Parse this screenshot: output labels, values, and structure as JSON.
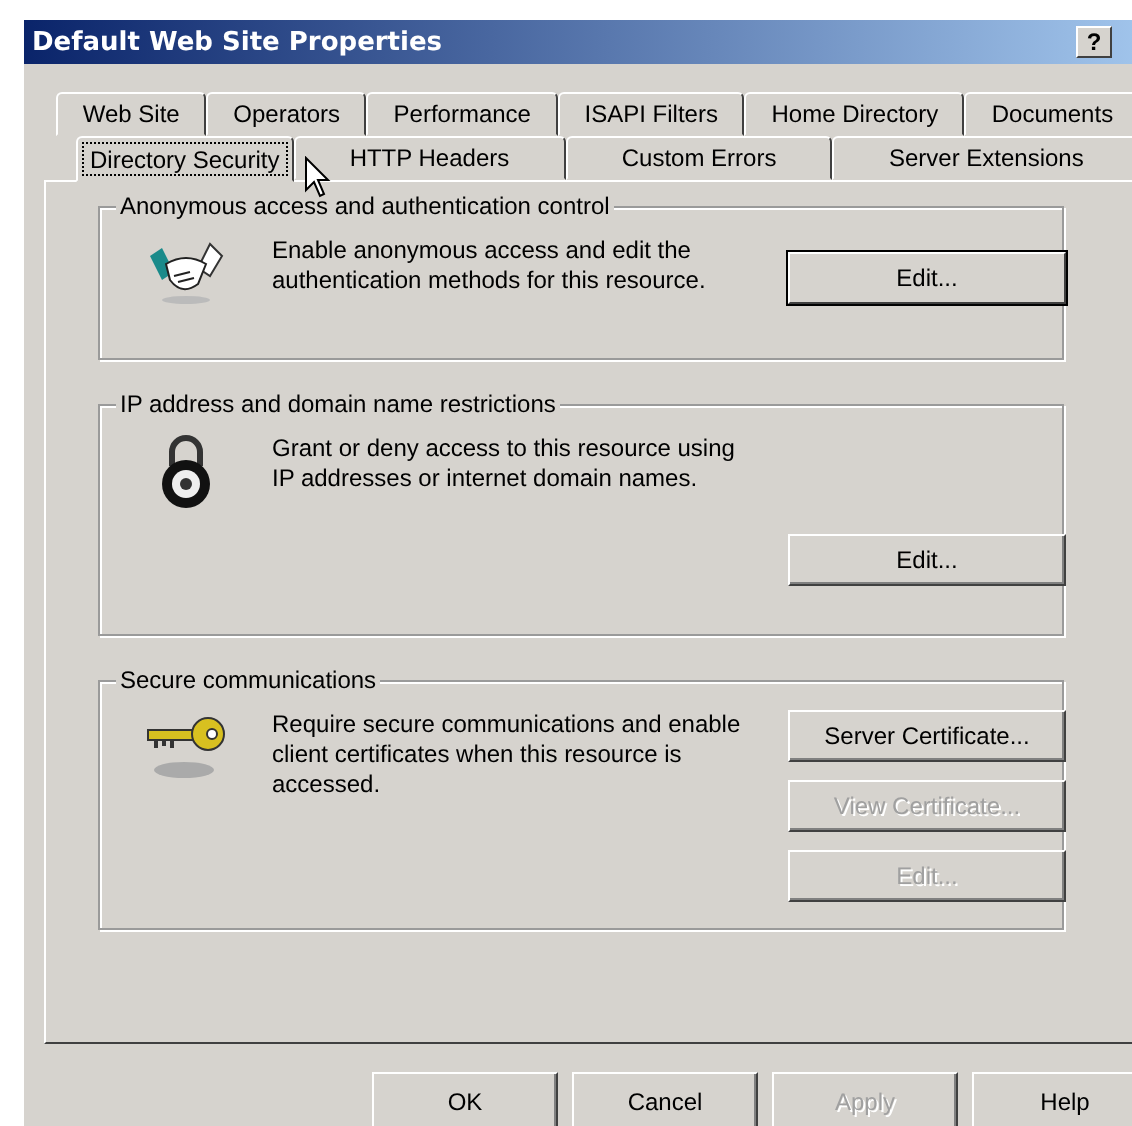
{
  "window": {
    "title": "Default Web Site Properties",
    "help_button": "?"
  },
  "tab_rows": [
    [
      {
        "label": "Web Site",
        "selected": false
      },
      {
        "label": "Operators",
        "selected": false
      },
      {
        "label": "Performance",
        "selected": false
      },
      {
        "label": "ISAPI Filters",
        "selected": false
      },
      {
        "label": "Home Directory",
        "selected": false
      },
      {
        "label": "Documents",
        "selected": false
      }
    ],
    [
      {
        "label": "Directory Security",
        "selected": true
      },
      {
        "label": "HTTP Headers",
        "selected": false
      },
      {
        "label": "Custom Errors",
        "selected": false
      },
      {
        "label": "Server Extensions",
        "selected": false
      }
    ]
  ],
  "groups": [
    {
      "title": "Anonymous access and authentication control",
      "description": "Enable anonymous access and edit the authentication methods for this resource.",
      "buttons": [
        {
          "label": "Edit...",
          "disabled": false,
          "default": true
        }
      ]
    },
    {
      "title": "IP address and domain name restrictions",
      "description": "Grant or deny access to this resource using IP addresses or internet domain names.",
      "buttons": [
        {
          "label": "Edit...",
          "disabled": false,
          "default": false
        }
      ]
    },
    {
      "title": "Secure communications",
      "description": "Require secure communications and enable client certificates when this resource is accessed.",
      "buttons": [
        {
          "label": "Server Certificate...",
          "disabled": false,
          "default": false
        },
        {
          "label": "View Certificate...",
          "disabled": true,
          "default": false
        },
        {
          "label": "Edit...",
          "disabled": true,
          "default": false
        }
      ]
    }
  ],
  "footer_buttons": [
    {
      "label": "OK",
      "disabled": false
    },
    {
      "label": "Cancel",
      "disabled": false
    },
    {
      "label": "Apply",
      "disabled": true
    },
    {
      "label": "Help",
      "disabled": false
    }
  ]
}
